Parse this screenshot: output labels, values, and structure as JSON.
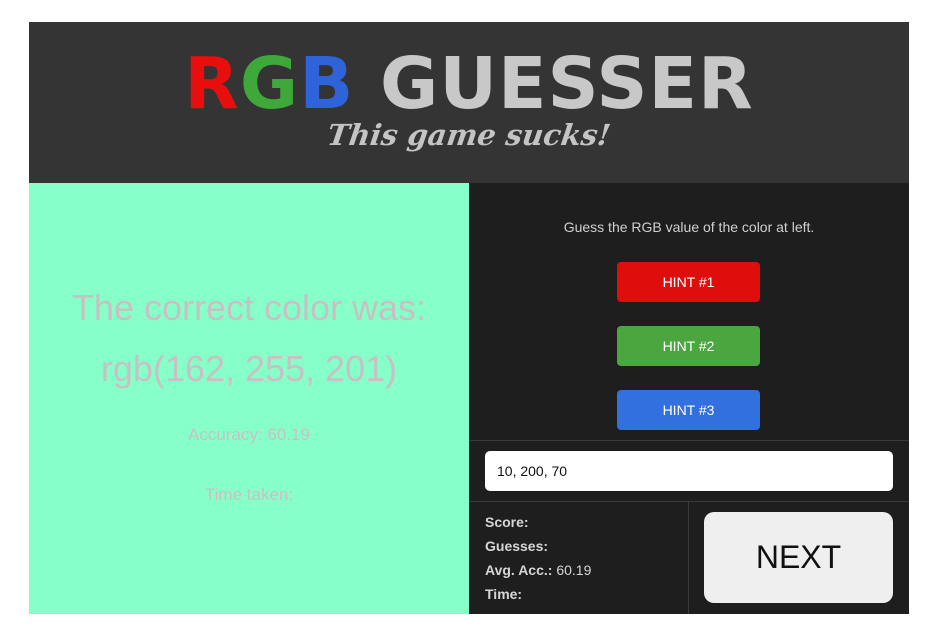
{
  "header": {
    "title_r": "R",
    "title_g": "G",
    "title_b": "B",
    "title_rest": " GUESSER",
    "subtitle": "This game sucks!"
  },
  "result": {
    "swatch_color": "#87ffc9",
    "correct_label": "The correct color was:",
    "correct_value": "rgb(162, 255, 201)",
    "accuracy_label": "Accuracy:",
    "accuracy_value": "60.19",
    "time_label": "Time taken:",
    "time_value": ""
  },
  "panel": {
    "instructions": "Guess the RGB value of the color at left.",
    "hints": [
      {
        "label": "HINT #1",
        "color": "#e00d0d"
      },
      {
        "label": "HINT #2",
        "color": "#4aa63e"
      },
      {
        "label": "HINT #3",
        "color": "#3270e0"
      }
    ],
    "guess_value": "10, 200, 70"
  },
  "stats": {
    "score_label": "Score:",
    "score_value": "",
    "guesses_label": "Guesses:",
    "guesses_value": "",
    "avg_acc_label": "Avg. Acc.:",
    "avg_acc_value": "60.19",
    "time_label": "Time:",
    "time_value": ""
  },
  "next_label": "NEXT"
}
